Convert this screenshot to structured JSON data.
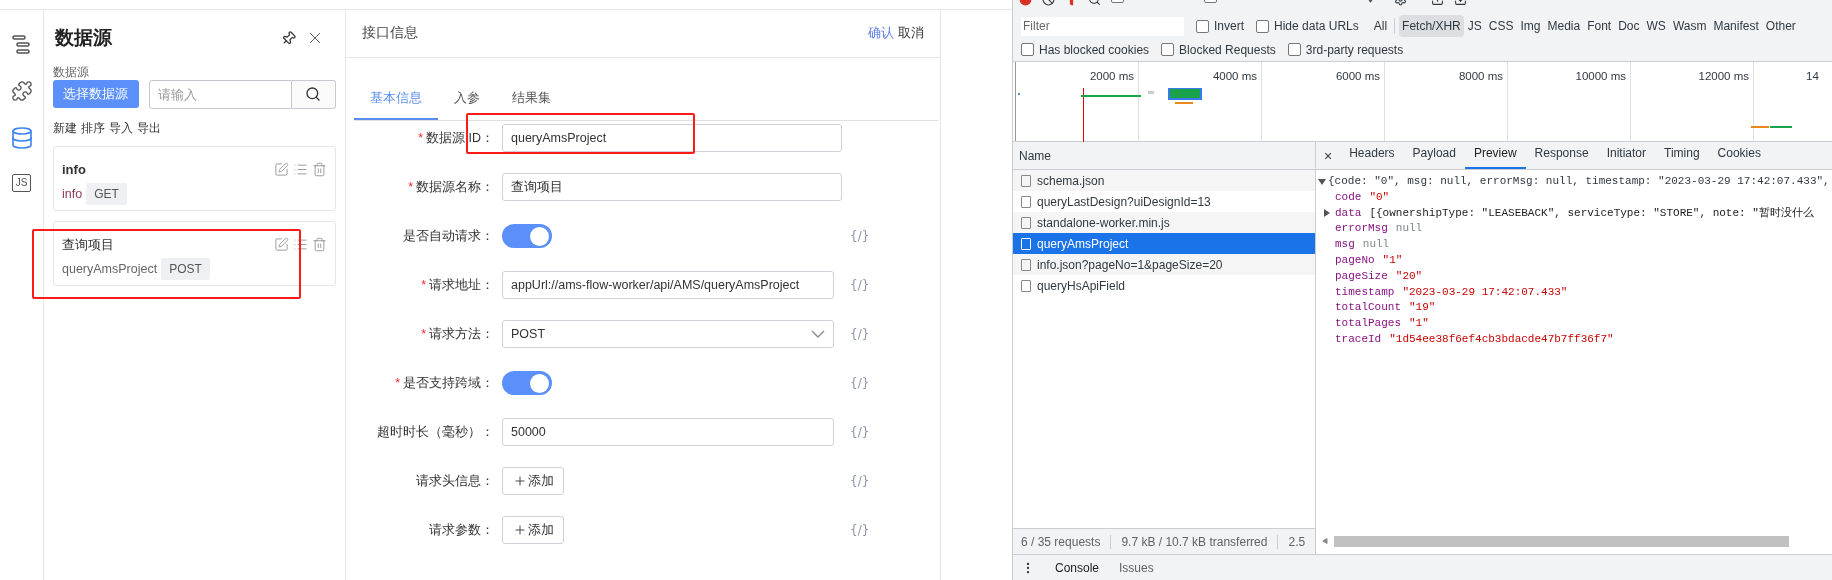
{
  "icon_bar": [
    {
      "kind": "outline",
      "selected": false
    },
    {
      "kind": "plugin",
      "selected": false
    },
    {
      "kind": "database",
      "selected": true
    },
    {
      "kind": "script",
      "selected": false,
      "label": "JS"
    }
  ],
  "datasource_panel": {
    "title": "数据源",
    "field_label": "数据源",
    "select_button": "选择数据源",
    "search_placeholder": "请输入",
    "actions": [
      "新建",
      "排序",
      "导入",
      "导出"
    ],
    "cards": [
      {
        "title": "info",
        "id": "info",
        "method": "GET"
      },
      {
        "title": "查询项目",
        "id": "queryAmsProject",
        "method": "POST",
        "highlighted": true
      }
    ]
  },
  "form_panel": {
    "title": "接口信息",
    "confirm": "确认",
    "cancel": "取消",
    "tabs": [
      {
        "label": "基本信息",
        "selected": true
      },
      {
        "label": "入参",
        "selected": false
      },
      {
        "label": "结果集",
        "selected": false
      }
    ],
    "fields": [
      {
        "kind": "text",
        "mark": "*",
        "label": "数据源 ID：",
        "value": "queryAmsProject",
        "highlighted": true
      },
      {
        "kind": "text",
        "mark": "*",
        "label": "数据源名称：",
        "value": "查询项目"
      },
      {
        "kind": "switch",
        "label": "是否自动请求：",
        "on": true,
        "code": "{/}"
      },
      {
        "kind": "text",
        "mark": "*",
        "label": "请求地址：",
        "value": "appUrl://ams-flow-worker/api/AMS/queryAmsProject",
        "code": "{/}"
      },
      {
        "kind": "select",
        "mark": "*",
        "label": "请求方法：",
        "value": "POST",
        "code": "{/}"
      },
      {
        "kind": "switch",
        "mark": "*",
        "label": "是否支持跨域：",
        "on": true,
        "code": "{/}"
      },
      {
        "kind": "text",
        "label": "超时时长（毫秒）：",
        "value": "50000",
        "code": "{/}"
      },
      {
        "kind": "add",
        "label": "请求头信息：",
        "button": "添加",
        "code": "{/}"
      },
      {
        "kind": "add",
        "label": "请求参数：",
        "button": "添加",
        "code": "{/}"
      }
    ]
  },
  "devtools": {
    "toolbar": [
      {
        "kind": "checkbox",
        "checked": false
      },
      {
        "kind": "checkbox",
        "checked": false
      },
      {
        "kind": "dropdown"
      }
    ],
    "filter": {
      "placeholder": "Filter"
    },
    "filter_options": [
      {
        "label": "Invert",
        "checked": false
      },
      {
        "label": "Hide data URLs",
        "checked": false
      }
    ],
    "type_filters": [
      {
        "label": "All",
        "selected": false
      },
      {
        "label": "Fetch/XHR",
        "selected": true
      },
      {
        "label": "JS",
        "selected": false
      },
      {
        "label": "CSS",
        "selected": false
      },
      {
        "label": "Img",
        "selected": false
      },
      {
        "label": "Media",
        "selected": false
      },
      {
        "label": "Font",
        "selected": false
      },
      {
        "label": "Doc",
        "selected": false
      },
      {
        "label": "WS",
        "selected": false
      },
      {
        "label": "Wasm",
        "selected": false
      },
      {
        "label": "Manifest",
        "selected": false
      },
      {
        "label": "Other",
        "selected": false
      }
    ],
    "blocked_options": [
      {
        "label": "Has blocked cookies",
        "checked": false
      },
      {
        "label": "Blocked Requests",
        "checked": false
      },
      {
        "label": "3rd-party requests",
        "checked": false
      }
    ],
    "timeline_ticks": [
      "2000 ms",
      "4000 ms",
      "6000 ms",
      "8000 ms",
      "10000 ms",
      "12000 ms",
      "14"
    ],
    "requests_header": "Name",
    "requests": [
      {
        "name": "schema.json",
        "selected": false
      },
      {
        "name": "queryLastDesign?uiDesignId=13",
        "selected": false
      },
      {
        "name": "standalone-worker.min.js",
        "selected": false
      },
      {
        "name": "queryAmsProject",
        "selected": true
      },
      {
        "name": "info.json?pageNo=1&pageSize=20",
        "selected": false
      },
      {
        "name": "queryHsApiField",
        "selected": false
      }
    ],
    "detail_close": "×",
    "detail_tabs": [
      {
        "label": "Headers",
        "selected": false
      },
      {
        "label": "Payload",
        "selected": false
      },
      {
        "label": "Preview",
        "selected": true
      },
      {
        "label": "Response",
        "selected": false
      },
      {
        "label": "Initiator",
        "selected": false
      },
      {
        "label": "Timing",
        "selected": false
      },
      {
        "label": "Cookies",
        "selected": false
      }
    ],
    "preview": {
      "summary": "{code: \"0\", msg: null, errorMsg: null, timestamp: \"2023-03-29 17:42:07.433\",",
      "expanded": true,
      "properties": [
        {
          "key": "code",
          "value": "\"0\"",
          "kind": "string"
        },
        {
          "key": "data",
          "value": "[{ownershipType: \"LEASEBACK\", serviceType: \"STORE\", note: \"暂时没什么",
          "kind": "object",
          "expanded": false
        },
        {
          "key": "errorMsg",
          "value": "null",
          "kind": "null"
        },
        {
          "key": "msg",
          "value": "null",
          "kind": "null"
        },
        {
          "key": "pageNo",
          "value": "\"1\"",
          "kind": "string"
        },
        {
          "key": "pageSize",
          "value": "\"20\"",
          "kind": "string"
        },
        {
          "key": "timestamp",
          "value": "\"2023-03-29 17:42:07.433\"",
          "kind": "string"
        },
        {
          "key": "totalCount",
          "value": "\"19\"",
          "kind": "string"
        },
        {
          "key": "totalPages",
          "value": "\"1\"",
          "kind": "string"
        },
        {
          "key": "traceId",
          "value": "\"1d54ee38f6ef4cb3bdacde47b7ff36f7\"",
          "kind": "string"
        }
      ]
    },
    "status": [
      "6 / 35 requests",
      "9.7 kB / 10.7 kB transferred",
      "2.5"
    ],
    "drawer_tabs": [
      "Console",
      "Issues"
    ]
  }
}
